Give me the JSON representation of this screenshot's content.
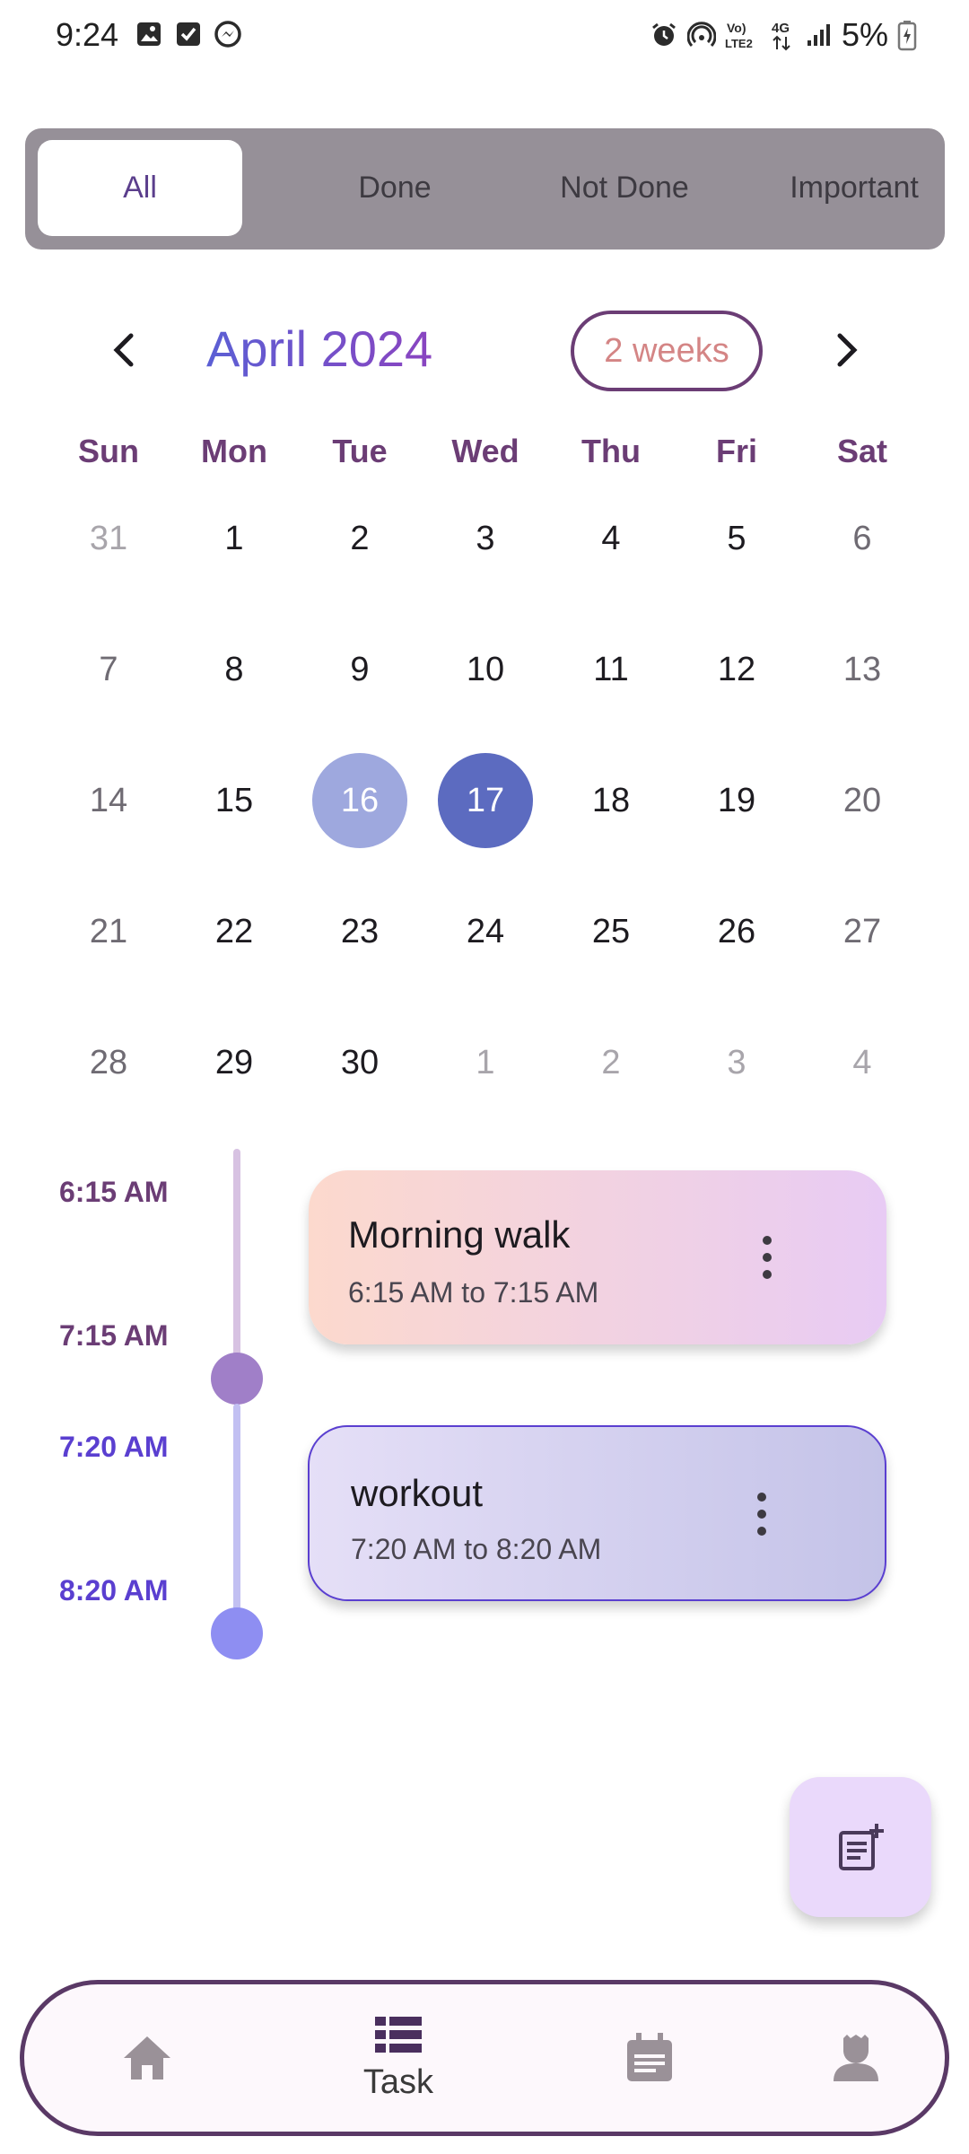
{
  "status_bar": {
    "time": "9:24",
    "battery": "5%",
    "left_icons": [
      "image-icon",
      "checkbox-icon",
      "messenger-icon"
    ],
    "right_icons": [
      "alarm-icon",
      "hotspot-icon",
      "volte-icon",
      "4g-icon",
      "signal-icon",
      "battery-icon"
    ],
    "volte_label": "Vo) LTE2",
    "network_label": "4G"
  },
  "filter": {
    "tabs": [
      {
        "label": "All",
        "active": true
      },
      {
        "label": "Done",
        "active": false
      },
      {
        "label": "Not Done",
        "active": false
      },
      {
        "label": "Important",
        "active": false
      }
    ]
  },
  "calendar": {
    "month_title": "April 2024",
    "format_button": "2 weeks",
    "prev_icon": "chevron-left-icon",
    "next_icon": "chevron-right-icon",
    "weekdays": [
      "Sun",
      "Mon",
      "Tue",
      "Wed",
      "Thu",
      "Fri",
      "Sat"
    ],
    "weeks": [
      [
        "31",
        "1",
        "2",
        "3",
        "4",
        "5",
        "6"
      ],
      [
        "7",
        "8",
        "9",
        "10",
        "11",
        "12",
        "13"
      ],
      [
        "14",
        "15",
        "16",
        "17",
        "18",
        "19",
        "20"
      ],
      [
        "21",
        "22",
        "23",
        "24",
        "25",
        "26",
        "27"
      ],
      [
        "28",
        "29",
        "30",
        "1",
        "2",
        "3",
        "4"
      ]
    ],
    "today": "16",
    "selected": "17"
  },
  "tasks": [
    {
      "title": "Morning walk",
      "range": "6:15 AM to 7:15 AM",
      "start_label": "6:15 AM",
      "end_label": "7:15 AM",
      "accent": "#6b3d75",
      "gradient": [
        "#fcd9cd",
        "#e8cbf4"
      ]
    },
    {
      "title": "workout",
      "range": "7:20 AM to 8:20 AM",
      "start_label": "7:20 AM",
      "end_label": "8:20 AM",
      "accent": "#5a3fd0",
      "gradient": [
        "#e5dff7",
        "#c4c3e8"
      ]
    }
  ],
  "fab": {
    "icon": "add-note-icon"
  },
  "bottom_nav": {
    "items": [
      {
        "icon": "home-icon",
        "label": ""
      },
      {
        "icon": "task-list-icon",
        "label": "Task"
      },
      {
        "icon": "calendar-note-icon",
        "label": ""
      },
      {
        "icon": "profile-icon",
        "label": ""
      }
    ]
  }
}
